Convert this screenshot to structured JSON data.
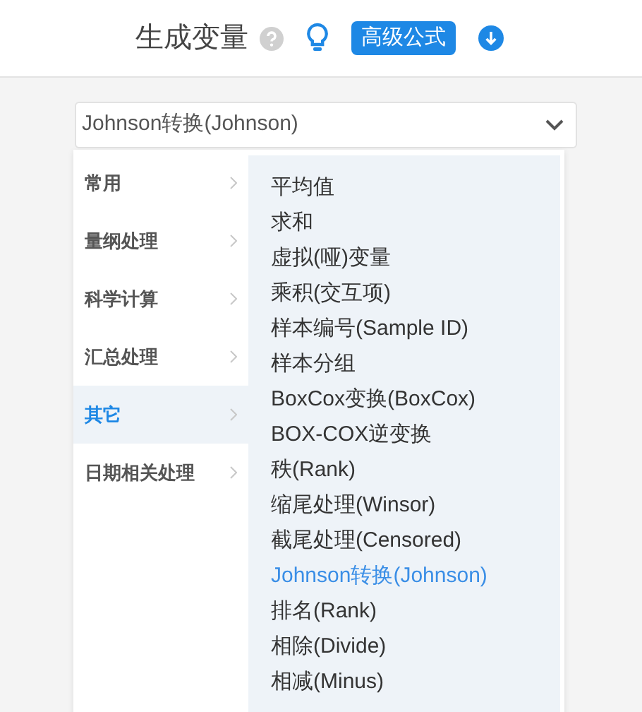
{
  "title": "生成变量",
  "advanced_button": "高级公式",
  "select": {
    "value": "Johnson转换(Johnson)"
  },
  "categories": [
    {
      "label": "常用",
      "selected": false
    },
    {
      "label": "量纲处理",
      "selected": false
    },
    {
      "label": "科学计算",
      "selected": false
    },
    {
      "label": "汇总处理",
      "selected": false
    },
    {
      "label": "其它",
      "selected": true
    },
    {
      "label": "日期相关处理",
      "selected": false
    }
  ],
  "options": [
    {
      "label": "平均值",
      "selected": false
    },
    {
      "label": "求和",
      "selected": false
    },
    {
      "label": "虚拟(哑)变量",
      "selected": false
    },
    {
      "label": "乘积(交互项)",
      "selected": false
    },
    {
      "label": "样本编号(Sample ID)",
      "selected": false
    },
    {
      "label": "样本分组",
      "selected": false
    },
    {
      "label": "BoxCox变换(BoxCox)",
      "selected": false
    },
    {
      "label": "BOX-COX逆变换",
      "selected": false
    },
    {
      "label": "秩(Rank)",
      "selected": false
    },
    {
      "label": "缩尾处理(Winsor)",
      "selected": false
    },
    {
      "label": "截尾处理(Censored)",
      "selected": false
    },
    {
      "label": "Johnson转换(Johnson)",
      "selected": true
    },
    {
      "label": "排名(Rank)",
      "selected": false
    },
    {
      "label": "相除(Divide)",
      "selected": false
    },
    {
      "label": "相减(Minus)",
      "selected": false
    }
  ]
}
